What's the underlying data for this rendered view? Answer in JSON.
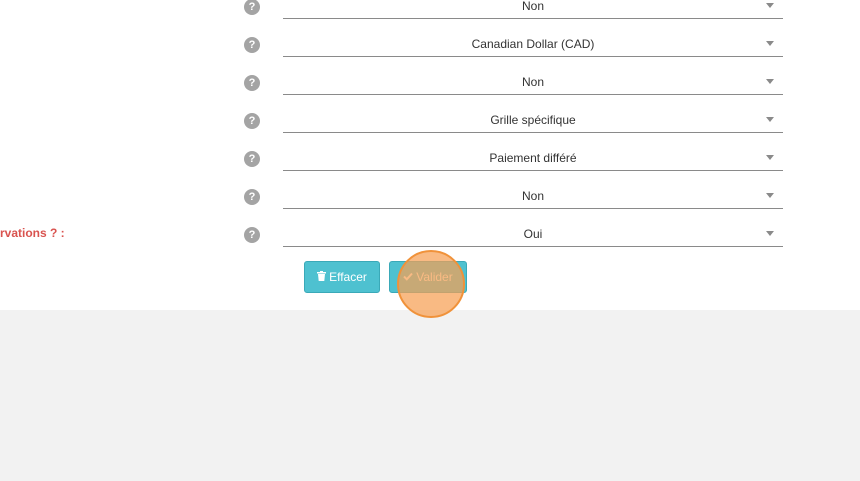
{
  "form": {
    "help_glyph": "?",
    "rows": [
      {
        "label": "",
        "value": "Non"
      },
      {
        "label": "",
        "value": "Canadian Dollar (CAD)"
      },
      {
        "label": "",
        "value": "Non"
      },
      {
        "label": "",
        "value": "Grille spécifique"
      },
      {
        "label": "",
        "value": "Paiement différé"
      },
      {
        "label": "",
        "value": "Non"
      },
      {
        "label": "rvations ? :",
        "value": "Oui"
      }
    ]
  },
  "buttons": {
    "clear_label": "Effacer",
    "clear_icon": "trash-icon",
    "submit_label": "Valider",
    "submit_icon": "check-icon"
  },
  "colors": {
    "button": "#4ec1d0",
    "label_error": "#d9534f",
    "click_marker": "#f7a053",
    "page_background": "#f2f2f2"
  }
}
